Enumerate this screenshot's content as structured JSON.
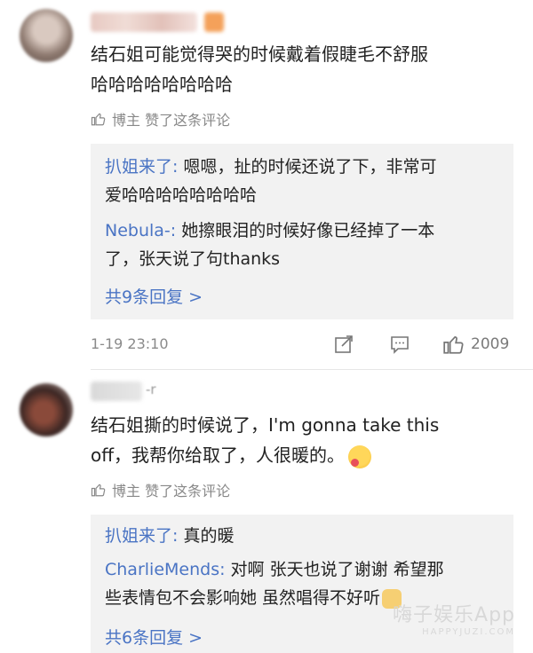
{
  "comments": [
    {
      "text_line1": "结石姐可能觉得哭的时候戴着假睫毛不舒服",
      "text_line2": "哈哈哈哈哈哈哈哈",
      "meta": "博主 赞了这条评论",
      "replies": [
        {
          "name": "扒姐来了:",
          "line1": " 嗯嗯，扯的时候还说了下，非常可",
          "line2": "爱哈哈哈哈哈哈哈哈"
        },
        {
          "name": "Nebula-:",
          "line1": " 她擦眼泪的时候好像已经掉了一本",
          "line2": "了，张天说了句thanks"
        }
      ],
      "more": "共9条回复 >",
      "time": "1-19 23:10",
      "like_count": "2009"
    },
    {
      "username": "-r",
      "text_line1": "结石姐撕的时候说了，I'm gonna take this",
      "text_line2": "off，我帮你给取了，人很暖的。",
      "meta": "博主 赞了这条评论",
      "replies": [
        {
          "name": "扒姐来了:",
          "line1": " 真的暖"
        },
        {
          "name": "CharlieMends:",
          "line1": " 对啊 张天也说了谢谢 希望那",
          "line2": "些表情包不会影响她 虽然唱得不好听"
        }
      ],
      "more": "共6条回复 >"
    }
  ],
  "watermark": {
    "line1": "嗨子娱乐App",
    "line2": "HAPPYJUZI.COM"
  },
  "icons": [
    "thumb-up-icon",
    "share-icon",
    "comment-icon",
    "like-icon"
  ]
}
